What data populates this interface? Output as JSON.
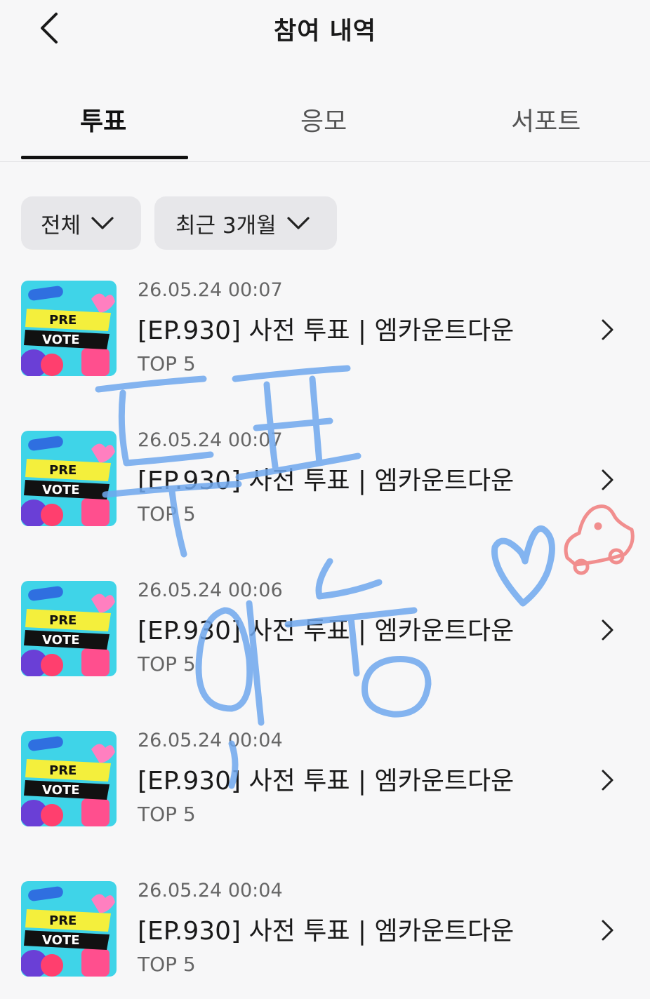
{
  "header": {
    "title": "참여 내역",
    "back_icon": "chevron-left-icon"
  },
  "tabs": [
    {
      "label": "투표",
      "active": true
    },
    {
      "label": "응모",
      "active": false
    },
    {
      "label": "서포트",
      "active": false
    }
  ],
  "filters": {
    "type": {
      "label": "전체",
      "icon": "chevron-down-icon"
    },
    "period": {
      "label": "최근 3개월",
      "icon": "chevron-down-icon"
    }
  },
  "thumbnail": {
    "line1": "PRE",
    "line2": "VOTE"
  },
  "items": [
    {
      "date": "26.05.24 00:07",
      "title": "[EP.930] 사전 투표 | 엠카운트다운",
      "subtitle": "TOP 5"
    },
    {
      "date": "26.05.24 00:07",
      "title": "[EP.930] 사전 투표 | 엠카운트다운",
      "subtitle": "TOP 5"
    },
    {
      "date": "26.05.24 00:06",
      "title": "[EP.930] 사전 투표 | 엠카운트다운",
      "subtitle": "TOP 5"
    },
    {
      "date": "26.05.24 00:04",
      "title": "[EP.930] 사전 투표 | 엠카운트다운",
      "subtitle": "TOP 5"
    },
    {
      "date": "26.05.24 00:04",
      "title": "[EP.930] 사전 투표 | 엠카운트다운",
      "subtitle": "TOP 5"
    }
  ],
  "colors": {
    "accent": "#111111",
    "doodle_blue": "#6fa8ee",
    "doodle_red": "#f07c7c"
  }
}
